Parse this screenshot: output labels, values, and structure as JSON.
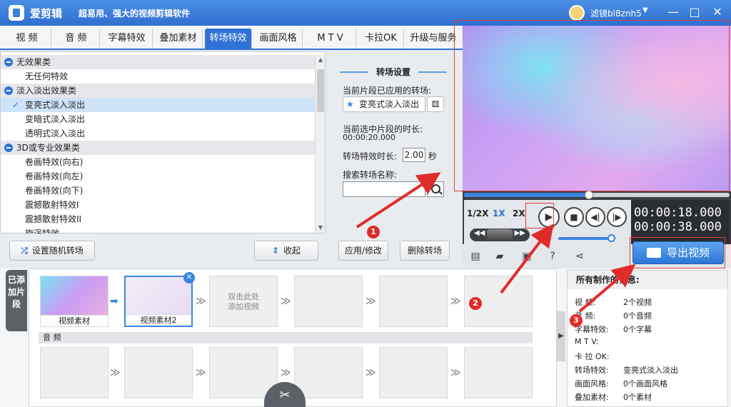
{
  "app": {
    "name": "爱剪辑",
    "slogan": "超易用、强大的视频剪辑软件",
    "user": "滤镜bl8znh5",
    "window_controls": [
      "—",
      "□",
      "✕"
    ]
  },
  "tabs": [
    {
      "label": "视  频"
    },
    {
      "label": "音  频"
    },
    {
      "label": "字幕特效"
    },
    {
      "label": "叠加素材"
    },
    {
      "label": "转场特效"
    },
    {
      "label": "画面风格"
    },
    {
      "label": "M T V"
    },
    {
      "label": "卡拉OK"
    },
    {
      "label": "升级与服务"
    }
  ],
  "active_tab": "转场特效",
  "effects": {
    "rows": [
      {
        "label": "无效果类",
        "type": "category"
      },
      {
        "label": "无任何特效",
        "type": "item"
      },
      {
        "label": "淡入淡出效果类",
        "type": "category"
      },
      {
        "label": "变亮式淡入淡出",
        "type": "item",
        "selected": true
      },
      {
        "label": "变暗式淡入淡出",
        "type": "item"
      },
      {
        "label": "透明式淡入淡出",
        "type": "item"
      },
      {
        "label": "3D或专业效果类",
        "type": "category"
      },
      {
        "label": "卷画特效(向右)",
        "type": "item"
      },
      {
        "label": "卷画特效(向左)",
        "type": "item"
      },
      {
        "label": "卷画特效(向下)",
        "type": "item"
      },
      {
        "label": "震撼散射特效I",
        "type": "item"
      },
      {
        "label": "震撼散射特效II",
        "type": "item"
      },
      {
        "label": "旋涡特效",
        "type": "item"
      }
    ],
    "random_button": "设置随机转场",
    "collapse_button": "收起"
  },
  "settings": {
    "title": "转场设置",
    "applied_label": "当前片段已应用的转场:",
    "applied_value": "变亮式淡入淡出",
    "duration_label": "当前选中片段的时长:",
    "duration_value": "00:00:20.000",
    "effect_duration_label": "转场特效时长:",
    "effect_duration_value": "2.00",
    "effect_duration_unit": "秒",
    "search_label": "搜索转场名称:",
    "search_value": "",
    "apply_button": "应用/修改",
    "delete_button": "删除转场"
  },
  "player": {
    "progress": 0.47,
    "speeds": [
      "1/2X",
      "1X",
      "2X"
    ],
    "active_speed": "1X",
    "current_time": "00:00:18.000",
    "total_time": "00:00:38.000",
    "volume": 0.92,
    "export_button": "导出视频"
  },
  "clips": {
    "side_label": "已添加片段",
    "items": [
      {
        "caption": "视频素材",
        "kind": "thumb1"
      },
      {
        "caption": "视频素材2",
        "kind": "thumb2"
      }
    ],
    "add_hint": [
      "双击此处",
      "添加视频"
    ],
    "audio_label": "音 频"
  },
  "info": {
    "title": "所有制作的信息:",
    "rows": [
      {
        "k": "视    频:",
        "v": "2个视频"
      },
      {
        "k": "音    频:",
        "v": "0个音频"
      },
      {
        "k": "字幕特效:",
        "v": "0个字幕"
      },
      {
        "k": "M  T  V:",
        "v": ""
      },
      {
        "k": "卡 拉 OK:",
        "v": ""
      },
      {
        "k": "转场特效:",
        "v": "变亮式淡入淡出"
      },
      {
        "k": "画面风格:",
        "v": "0个画面风格"
      },
      {
        "k": "叠加素材:",
        "v": "0个素材"
      }
    ]
  },
  "annotations": [
    "1",
    "2",
    "3"
  ],
  "colors": {
    "accent": "#2f72d6",
    "annotation_red": "#e02b2b"
  }
}
